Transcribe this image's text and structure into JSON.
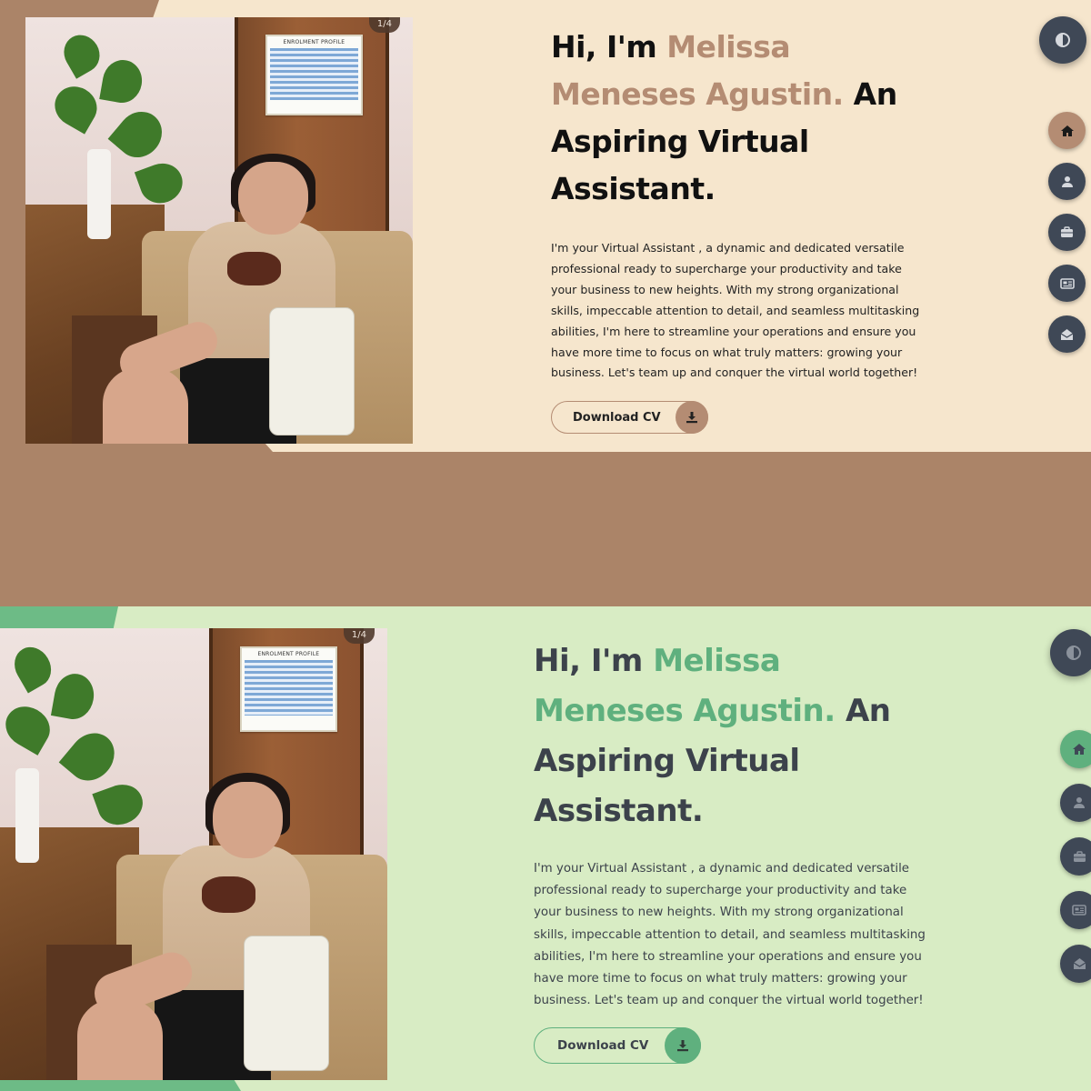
{
  "theme_beige": {
    "photo_counter": "1/4",
    "poster_title": "ENROLMENT PROFILE",
    "headline": {
      "greeting": "Hi, I'm ",
      "name": "Melissa Meneses Agustin.",
      "rest": " An Aspiring Virtual Assistant."
    },
    "bio": "I'm your Virtual Assistant , a dynamic and dedicated versatile professional ready to supercharge your productivity and take your business to new heights. With my strong organizational skills, impeccable attention to detail, and seamless multitasking abilities, I'm here to streamline your operations and ensure you have more time to focus on what truly matters: growing your business. Let's team up and conquer the virtual world together!",
    "download_cv_label": "Download CV",
    "colors": {
      "accent": "#b48c73",
      "background": "#f6e6cd",
      "nav": "#3f4856"
    }
  },
  "theme_green": {
    "photo_counter": "1/4",
    "poster_title": "ENROLMENT PROFILE",
    "headline": {
      "greeting": "Hi, I'm ",
      "name": "Melissa Meneses Agustin.",
      "rest": " An Aspiring Virtual Assistant."
    },
    "bio": "I'm your Virtual Assistant , a dynamic and dedicated versatile professional ready to supercharge your productivity and take your business to new heights. With my strong organizational skills, impeccable attention to detail, and seamless multitasking abilities, I'm here to streamline your operations and ensure you have more time to focus on what truly matters: growing your business. Let's team up and conquer the virtual world together!",
    "download_cv_label": "Download CV",
    "colors": {
      "accent": "#5fb07e",
      "background": "#d8ecc4",
      "nav": "#3f4856"
    }
  },
  "nav_icons": [
    "home-icon",
    "user-icon",
    "briefcase-icon",
    "newspaper-icon",
    "envelope-open-icon"
  ],
  "theme_toggle_icon": "contrast-icon",
  "download_icon": "download-icon",
  "separator_color": "#ab8468"
}
